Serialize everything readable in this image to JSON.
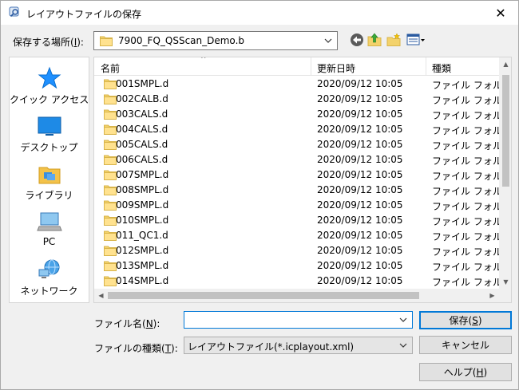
{
  "window": {
    "title": "レイアウトファイルの保存",
    "close_label": "✕"
  },
  "location": {
    "label_prefix": "保存する場所(",
    "label_key": "I",
    "label_suffix": "):",
    "folder": "7900_FQ_QSScan_Demo.b"
  },
  "places": [
    {
      "label": "クイック アクセス",
      "icon": "quick-access-star-icon"
    },
    {
      "label": "デスクトップ",
      "icon": "desktop-icon"
    },
    {
      "label": "ライブラリ",
      "icon": "library-icon"
    },
    {
      "label": "PC",
      "icon": "pc-icon"
    },
    {
      "label": "ネットワーク",
      "icon": "network-icon"
    }
  ],
  "columns": {
    "name": "名前",
    "date": "更新日時",
    "type": "種類"
  },
  "files": [
    {
      "name": "001SMPL.d",
      "date": "2020/09/12 10:05",
      "type": "ファイル フォルダー"
    },
    {
      "name": "002CALB.d",
      "date": "2020/09/12 10:05",
      "type": "ファイル フォルダー"
    },
    {
      "name": "003CALS.d",
      "date": "2020/09/12 10:05",
      "type": "ファイル フォルダー"
    },
    {
      "name": "004CALS.d",
      "date": "2020/09/12 10:05",
      "type": "ファイル フォルダー"
    },
    {
      "name": "005CALS.d",
      "date": "2020/09/12 10:05",
      "type": "ファイル フォルダー"
    },
    {
      "name": "006CALS.d",
      "date": "2020/09/12 10:05",
      "type": "ファイル フォルダー"
    },
    {
      "name": "007SMPL.d",
      "date": "2020/09/12 10:05",
      "type": "ファイル フォルダー"
    },
    {
      "name": "008SMPL.d",
      "date": "2020/09/12 10:05",
      "type": "ファイル フォルダー"
    },
    {
      "name": "009SMPL.d",
      "date": "2020/09/12 10:05",
      "type": "ファイル フォルダー"
    },
    {
      "name": "010SMPL.d",
      "date": "2020/09/12 10:05",
      "type": "ファイル フォルダー"
    },
    {
      "name": "011_QC1.d",
      "date": "2020/09/12 10:05",
      "type": "ファイル フォルダー"
    },
    {
      "name": "012SMPL.d",
      "date": "2020/09/12 10:05",
      "type": "ファイル フォルダー"
    },
    {
      "name": "013SMPL.d",
      "date": "2020/09/12 10:05",
      "type": "ファイル フォルダー"
    },
    {
      "name": "014SMPL.d",
      "date": "2020/09/12 10:05",
      "type": "ファイル フォルダー"
    }
  ],
  "filename": {
    "label_prefix": "ファイル名(",
    "label_key": "N",
    "label_suffix": "):",
    "value": ""
  },
  "filetype": {
    "label_prefix": "ファイルの種類(",
    "label_key": "T",
    "label_suffix": "):",
    "value": "レイアウトファイル(*.icplayout.xml)"
  },
  "buttons": {
    "save_prefix": "保存(",
    "save_key": "S",
    "save_suffix": ")",
    "cancel": "キャンセル",
    "help_prefix": "ヘルプ(",
    "help_key": "H",
    "help_suffix": ")"
  }
}
